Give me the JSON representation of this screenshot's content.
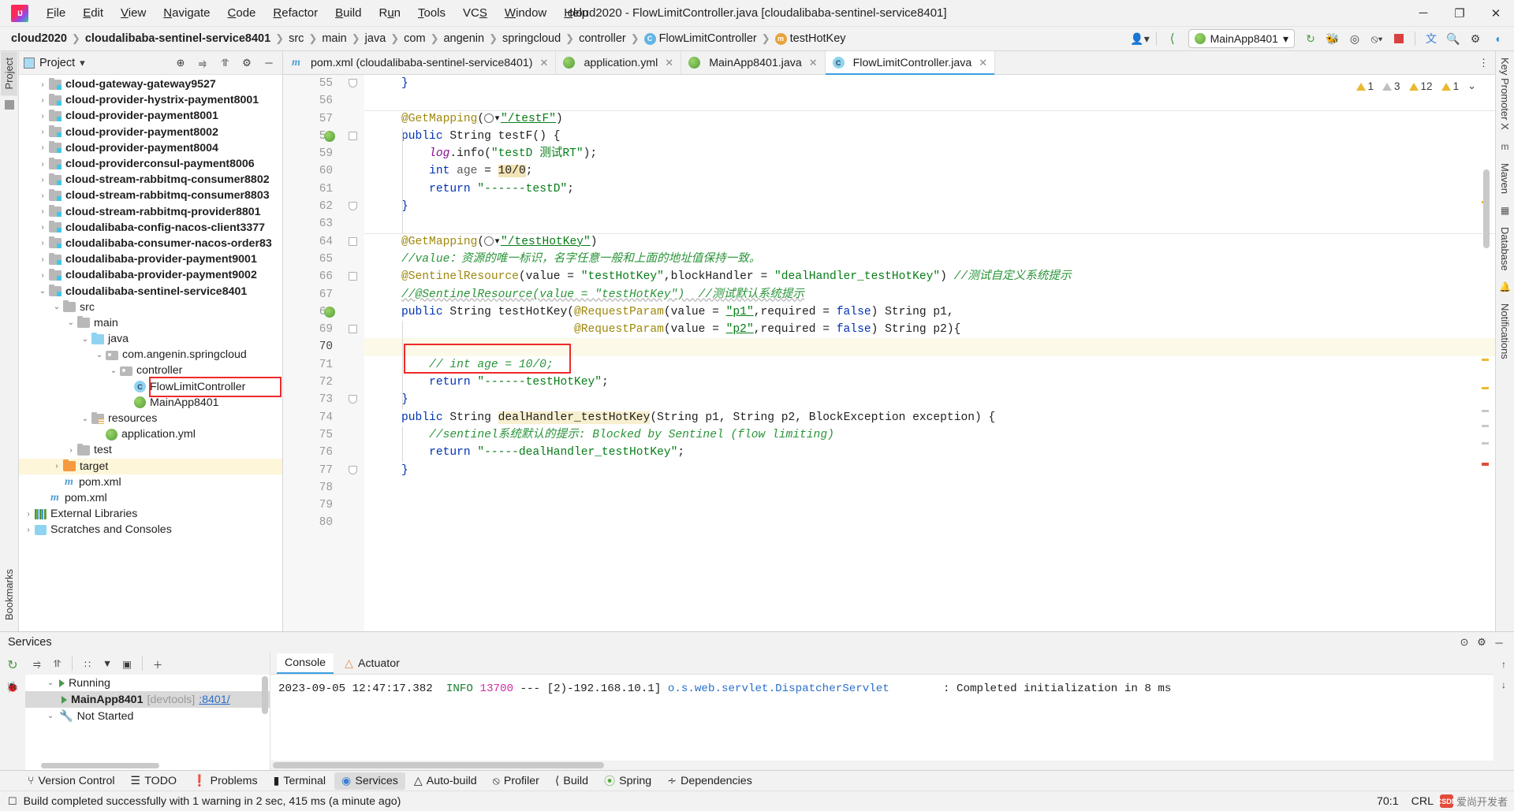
{
  "window": {
    "title": "cloud2020 - FlowLimitController.java [cloudalibaba-sentinel-service8401]",
    "logo": "intellij-idea-logo",
    "minimize": "─",
    "maximize": "❐",
    "close": "✕"
  },
  "menu": [
    {
      "label": "File"
    },
    {
      "label": "Edit"
    },
    {
      "label": "View"
    },
    {
      "label": "Navigate"
    },
    {
      "label": "Code"
    },
    {
      "label": "Refactor"
    },
    {
      "label": "Build"
    },
    {
      "label": "Run"
    },
    {
      "label": "Tools"
    },
    {
      "label": "VCS"
    },
    {
      "label": "Window"
    },
    {
      "label": "Help"
    }
  ],
  "breadcrumbs": [
    {
      "label": "cloud2020",
      "bold": true
    },
    {
      "label": "cloudalibaba-sentinel-service8401",
      "bold": true
    },
    {
      "label": "src"
    },
    {
      "label": "main"
    },
    {
      "label": "java"
    },
    {
      "label": "com"
    },
    {
      "label": "angenin"
    },
    {
      "label": "springcloud"
    },
    {
      "label": "controller"
    },
    {
      "label": "FlowLimitController",
      "icon": "class-icon"
    },
    {
      "label": "testHotKey",
      "icon": "method-icon"
    }
  ],
  "toolbar": {
    "run_config": "MainApp8401",
    "run_config_dropdown": "▾",
    "buttons": [
      {
        "name": "user-settings-icon",
        "glyph": "👤"
      },
      {
        "name": "build-hammer-icon",
        "glyph": "⚒"
      },
      {
        "name": "run-icon",
        "glyph": "▶"
      },
      {
        "name": "debug-icon",
        "glyph": "🐞"
      },
      {
        "name": "run-coverage-icon",
        "glyph": "◷"
      },
      {
        "name": "profile-icon",
        "glyph": "⦸"
      },
      {
        "name": "stop-icon",
        "glyph": "■"
      },
      {
        "name": "translate-icon",
        "glyph": "文"
      },
      {
        "name": "search-icon",
        "glyph": "🔍"
      },
      {
        "name": "settings-gear-icon",
        "glyph": "⚙"
      },
      {
        "name": "ide-feature-icon",
        "glyph": "◖"
      }
    ]
  },
  "left_rail": [
    {
      "label": "Project",
      "name": "tool-window-project",
      "selected": true
    },
    {
      "label": "Bookmarks",
      "name": "tool-window-bookmarks",
      "selected": false
    },
    {
      "label": "Structure",
      "name": "tool-window-structure",
      "selected": false
    }
  ],
  "right_rail": [
    {
      "label": "Key Promoter X",
      "name": "tool-window-key-promoter"
    },
    {
      "label": "Maven",
      "name": "tool-window-maven"
    },
    {
      "label": "Database",
      "name": "tool-window-database"
    },
    {
      "label": "Notifications",
      "name": "tool-window-notifications"
    }
  ],
  "project_panel": {
    "title": "Project",
    "dropdown": "▾",
    "actions": [
      {
        "name": "select-opened-file-icon",
        "glyph": "⊕"
      },
      {
        "name": "expand-all-icon",
        "glyph": "⥤"
      },
      {
        "name": "collapse-all-icon",
        "glyph": "⥣"
      },
      {
        "name": "settings-gear-icon",
        "glyph": "⚙"
      },
      {
        "name": "hide-panel-icon",
        "glyph": "─"
      }
    ],
    "tree": [
      {
        "label": "cloud-gateway-gateway9527",
        "depth": 1,
        "arrow": "›",
        "icon": "module-folder",
        "bold": true
      },
      {
        "label": "cloud-provider-hystrix-payment8001",
        "depth": 1,
        "arrow": "›",
        "icon": "module-folder",
        "bold": true
      },
      {
        "label": "cloud-provider-payment8001",
        "depth": 1,
        "arrow": "›",
        "icon": "module-folder",
        "bold": true
      },
      {
        "label": "cloud-provider-payment8002",
        "depth": 1,
        "arrow": "›",
        "icon": "module-folder",
        "bold": true
      },
      {
        "label": "cloud-provider-payment8004",
        "depth": 1,
        "arrow": "›",
        "icon": "module-folder",
        "bold": true
      },
      {
        "label": "cloud-providerconsul-payment8006",
        "depth": 1,
        "arrow": "›",
        "icon": "module-folder",
        "bold": true
      },
      {
        "label": "cloud-stream-rabbitmq-consumer8802",
        "depth": 1,
        "arrow": "›",
        "icon": "module-folder",
        "bold": true
      },
      {
        "label": "cloud-stream-rabbitmq-consumer8803",
        "depth": 1,
        "arrow": "›",
        "icon": "module-folder",
        "bold": true
      },
      {
        "label": "cloud-stream-rabbitmq-provider8801",
        "depth": 1,
        "arrow": "›",
        "icon": "module-folder",
        "bold": true
      },
      {
        "label": "cloudalibaba-config-nacos-client3377",
        "depth": 1,
        "arrow": "›",
        "icon": "module-folder",
        "bold": true
      },
      {
        "label": "cloudalibaba-consumer-nacos-order83",
        "depth": 1,
        "arrow": "›",
        "icon": "module-folder",
        "bold": true
      },
      {
        "label": "cloudalibaba-provider-payment9001",
        "depth": 1,
        "arrow": "›",
        "icon": "module-folder",
        "bold": true
      },
      {
        "label": "cloudalibaba-provider-payment9002",
        "depth": 1,
        "arrow": "›",
        "icon": "module-folder",
        "bold": true
      },
      {
        "label": "cloudalibaba-sentinel-service8401",
        "depth": 1,
        "arrow": "⌄",
        "icon": "module-folder",
        "bold": true
      },
      {
        "label": "src",
        "depth": 2,
        "arrow": "⌄",
        "icon": "folder"
      },
      {
        "label": "main",
        "depth": 3,
        "arrow": "⌄",
        "icon": "folder"
      },
      {
        "label": "java",
        "depth": 4,
        "arrow": "⌄",
        "icon": "source-folder"
      },
      {
        "label": "com.angenin.springcloud",
        "depth": 5,
        "arrow": "⌄",
        "icon": "package"
      },
      {
        "label": "controller",
        "depth": 6,
        "arrow": "⌄",
        "icon": "package"
      },
      {
        "label": "FlowLimitController",
        "depth": 7,
        "arrow": "",
        "icon": "java-class",
        "highlighted_box": true
      },
      {
        "label": "MainApp8401",
        "depth": 7,
        "arrow": "",
        "icon": "spring-boot-class"
      },
      {
        "label": "resources",
        "depth": 4,
        "arrow": "⌄",
        "icon": "resources-folder"
      },
      {
        "label": "application.yml",
        "depth": 5,
        "arrow": "",
        "icon": "spring-yaml"
      },
      {
        "label": "test",
        "depth": 3,
        "arrow": "›",
        "icon": "folder"
      },
      {
        "label": "target",
        "depth": 2,
        "arrow": "›",
        "icon": "target-folder",
        "row_highlight": true
      },
      {
        "label": "pom.xml",
        "depth": 2,
        "arrow": "",
        "icon": "maven"
      },
      {
        "label": "pom.xml",
        "depth": 1,
        "arrow": "",
        "icon": "maven"
      },
      {
        "label": "External Libraries",
        "depth": 0,
        "arrow": "›",
        "icon": "libraries"
      },
      {
        "label": "Scratches and Consoles",
        "depth": 0,
        "arrow": "›",
        "icon": "scratches"
      }
    ]
  },
  "editor": {
    "tabs": [
      {
        "label": "pom.xml (cloudalibaba-sentinel-service8401)",
        "icon": "maven-icon",
        "active": false,
        "close": "✕"
      },
      {
        "label": "application.yml",
        "icon": "spring-yaml-icon",
        "active": false,
        "close": "✕"
      },
      {
        "label": "MainApp8401.java",
        "icon": "spring-class-icon",
        "active": false,
        "close": "✕"
      },
      {
        "label": "FlowLimitController.java",
        "icon": "java-class-icon",
        "active": true,
        "close": "✕"
      }
    ],
    "tab_overflow": "⋮",
    "inspections": [
      {
        "name": "warning-count-1",
        "icon": "warning-triangle",
        "count": "1"
      },
      {
        "name": "warning-count-3",
        "icon": "warning-triangle",
        "count": "3"
      },
      {
        "name": "warning-count-12",
        "icon": "warning-triangle",
        "count": "12"
      },
      {
        "name": "weak-warning-count-1",
        "icon": "warning-triangle-grey",
        "count": "1"
      },
      {
        "name": "inspections-widget",
        "icon": "chevron-down",
        "count": "⌄"
      }
    ],
    "first_line": 55,
    "lines": [
      {
        "n": 55,
        "text": "    }",
        "tokens": [
          {
            "t": "    ",
            "c": ""
          },
          {
            "t": "}",
            "c": "kw"
          }
        ]
      },
      {
        "n": 56,
        "text": "",
        "tokens": []
      },
      {
        "n": 57,
        "text": "    @GetMapping(\"/testF\")",
        "tokens": []
      },
      {
        "n": 58,
        "text": "    public String testF() {",
        "tokens": []
      },
      {
        "n": 59,
        "text": "        log.info(\"testD 测试RT\");",
        "tokens": []
      },
      {
        "n": 60,
        "text": "        int age = 10/0;",
        "tokens": []
      },
      {
        "n": 61,
        "text": "        return \"------testD\";",
        "tokens": []
      },
      {
        "n": 62,
        "text": "    }",
        "tokens": []
      },
      {
        "n": 63,
        "text": "",
        "tokens": []
      },
      {
        "n": 64,
        "text": "    @GetMapping(\"/testHotKey\")",
        "tokens": []
      },
      {
        "n": 65,
        "text": "    //value: 资源的唯一标识，名字任意一般和上面的地址值保持一致。",
        "tokens": []
      },
      {
        "n": 66,
        "text": "    @SentinelResource(value = \"testHotKey\",blockHandler = \"dealHandler_testHotKey\") //测试自定义系统提示",
        "tokens": []
      },
      {
        "n": 67,
        "text": "    //@SentinelResource(value = \"testHotKey\")  //测试默认系统提示",
        "tokens": []
      },
      {
        "n": 68,
        "text": "    public String testHotKey(@RequestParam(value = \"p1\",required = false) String p1,",
        "tokens": []
      },
      {
        "n": 69,
        "text": "                             @RequestParam(value = \"p2\",required = false) String p2){",
        "tokens": []
      },
      {
        "n": 70,
        "text": "",
        "tokens": []
      },
      {
        "n": 71,
        "text": "        // int age = 10/0;",
        "tokens": []
      },
      {
        "n": 72,
        "text": "        return \"------testHotKey\";",
        "tokens": []
      },
      {
        "n": 73,
        "text": "    }",
        "tokens": []
      },
      {
        "n": 74,
        "text": "    public String dealHandler_testHotKey(String p1, String p2, BlockException exception) {",
        "tokens": []
      },
      {
        "n": 75,
        "text": "        //sentinel系统默认的提示: Blocked by Sentinel (flow limiting)",
        "tokens": []
      },
      {
        "n": 76,
        "text": "        return \"-----dealHandler_testHotKey\";",
        "tokens": []
      },
      {
        "n": 77,
        "text": "    }",
        "tokens": []
      },
      {
        "n": 78,
        "text": "",
        "tokens": []
      },
      {
        "n": 79,
        "text": "",
        "tokens": []
      },
      {
        "n": 80,
        "text": "",
        "tokens": []
      }
    ]
  },
  "services": {
    "title": "Services",
    "header_actions": [
      {
        "name": "help-icon",
        "glyph": "⊙"
      },
      {
        "name": "settings-gear-icon",
        "glyph": "⚙"
      },
      {
        "name": "hide-panel-icon",
        "glyph": "─"
      }
    ],
    "toolbar": [
      {
        "name": "rerun-icon",
        "glyph": "↻"
      },
      {
        "name": "debug-icon",
        "glyph": "🐞"
      }
    ],
    "tree_toolbar": [
      {
        "name": "expand-all-icon",
        "glyph": "⥤"
      },
      {
        "name": "collapse-all-icon",
        "glyph": "⥣"
      },
      {
        "name": "group-icon",
        "glyph": "∷"
      },
      {
        "name": "filter-icon",
        "glyph": "▼"
      },
      {
        "name": "add-service-icon",
        "glyph": "▣"
      },
      {
        "name": "plus-icon",
        "glyph": "＋"
      }
    ],
    "tree": [
      {
        "label": "Running",
        "depth": 0,
        "chevron": "⌄",
        "icon": "run-triangle",
        "bold": false
      },
      {
        "label": "MainApp8401",
        "suffix": "[devtools]",
        "link": ":8401/",
        "depth": 1,
        "chevron": "",
        "icon": "run-triangle",
        "bold": true,
        "selected": true
      },
      {
        "label": "Not Started",
        "depth": 0,
        "chevron": "⌄",
        "icon": "wrench"
      }
    ],
    "tabs": [
      {
        "label": "Console",
        "active": true,
        "icon": ""
      },
      {
        "label": "Actuator",
        "active": false,
        "icon": "actuator-icon"
      }
    ],
    "console": {
      "timestamp": "2023-09-05 12:47:17.382",
      "level": "INFO",
      "pid": "13700",
      "sep": "---",
      "thread": "[2)-192.168.10.1]",
      "logger": "o.s.web.servlet.DispatcherServlet",
      "message": ": Completed initialization in 8 ms"
    },
    "right_rail": [
      {
        "name": "scroll-to-top-icon",
        "glyph": "↑"
      },
      {
        "name": "scroll-to-end-icon",
        "glyph": "↓"
      }
    ]
  },
  "tool_windows": [
    {
      "label": "Version Control",
      "icon": "branch-icon",
      "active": false
    },
    {
      "label": "TODO",
      "icon": "todo-icon",
      "active": false
    },
    {
      "label": "Problems",
      "icon": "problems-icon",
      "active": false
    },
    {
      "label": "Terminal",
      "icon": "terminal-icon",
      "active": false
    },
    {
      "label": "Services",
      "icon": "services-icon",
      "active": true
    },
    {
      "label": "Auto-build",
      "icon": "autobuild-icon",
      "active": false
    },
    {
      "label": "Profiler",
      "icon": "profiler-icon",
      "active": false
    },
    {
      "label": "Build",
      "icon": "build-icon",
      "active": false
    },
    {
      "label": "Spring",
      "icon": "spring-icon",
      "active": false
    },
    {
      "label": "Dependencies",
      "icon": "dependencies-icon",
      "active": false
    }
  ],
  "statusbar": {
    "message": "Build completed successfully with 1 warning in 2 sec, 415 ms (a minute ago)",
    "icon": "event-log-icon",
    "caret": "70:1",
    "encoding": "CRL",
    "watermark": "爱尚开发者",
    "watermark_logo": "CSDN"
  }
}
